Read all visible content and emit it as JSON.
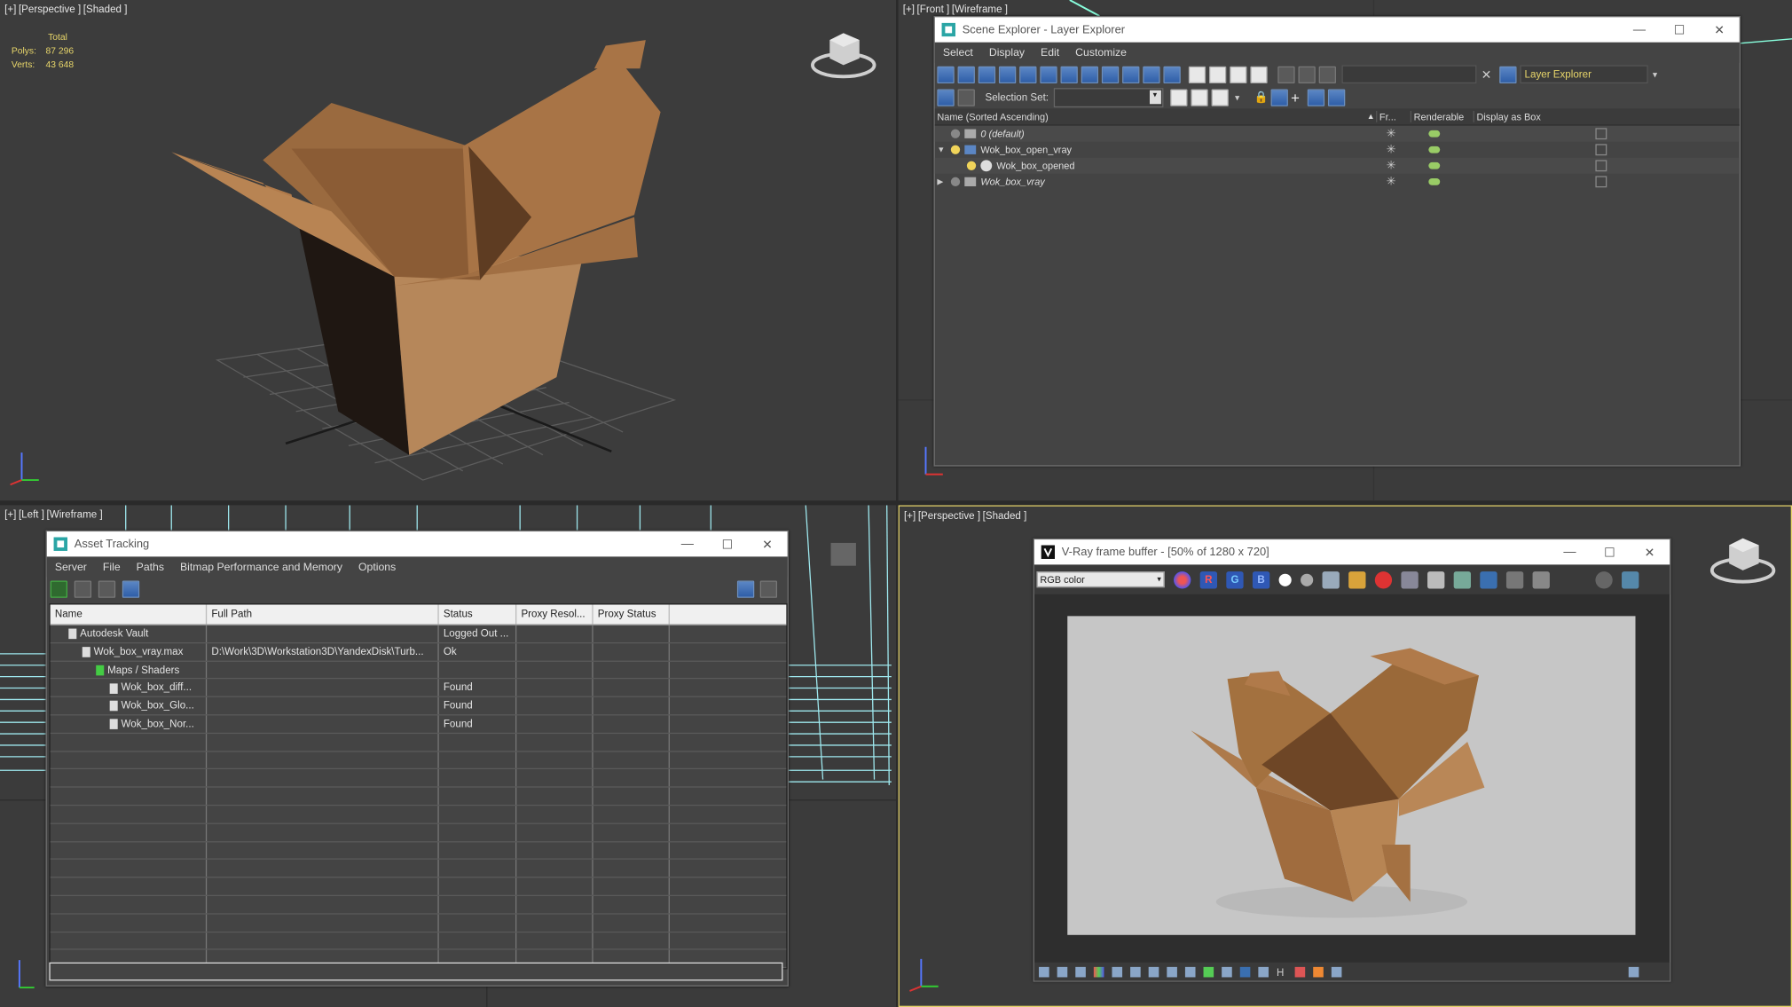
{
  "viewports": {
    "top_left": {
      "labels": [
        "[+]",
        "[Perspective ]",
        "[Shaded ]"
      ],
      "stats": {
        "header": "Total",
        "polys_label": "Polys:",
        "polys": "87 296",
        "verts_label": "Verts:",
        "verts": "43 648"
      }
    },
    "top_right": {
      "labels": [
        "[+]",
        "[Front ]",
        "[Wireframe ]"
      ]
    },
    "bottom_left": {
      "labels": [
        "[+]",
        "[Left ]",
        "[Wireframe ]"
      ]
    },
    "bottom_right": {
      "labels": [
        "[+]",
        "[Perspective ]",
        "[Shaded ]"
      ]
    }
  },
  "scene_explorer": {
    "title": "Scene Explorer - Layer Explorer",
    "menu": [
      "Select",
      "Display",
      "Edit",
      "Customize"
    ],
    "mode_dropdown": "Layer Explorer",
    "selection_set_label": "Selection Set:",
    "columns": [
      "Name (Sorted Ascending)",
      "Fr...",
      "Renderable",
      "Display as Box"
    ],
    "rows": [
      {
        "name": "0 (default)",
        "italic": true,
        "indent": 0,
        "expander": ""
      },
      {
        "name": "Wok_box_open_vray",
        "italic": false,
        "indent": 0,
        "expander": "▼"
      },
      {
        "name": "Wok_box_opened",
        "italic": false,
        "indent": 1,
        "expander": ""
      },
      {
        "name": "Wok_box_vray",
        "italic": true,
        "indent": 0,
        "expander": "▶"
      }
    ]
  },
  "asset_tracking": {
    "title": "Asset Tracking",
    "menu": [
      "Server",
      "File",
      "Paths",
      "Bitmap Performance and Memory",
      "Options"
    ],
    "columns": [
      "Name",
      "Full Path",
      "Status",
      "Proxy Resol...",
      "Proxy Status"
    ],
    "rows": [
      {
        "name": "Autodesk Vault",
        "path": "",
        "status": "Logged Out ...",
        "indent": 1
      },
      {
        "name": "Wok_box_vray.max",
        "path": "D:\\Work\\3D\\Workstation3D\\YandexDisk\\Turb...",
        "status": "Ok",
        "indent": 2
      },
      {
        "name": "Maps / Shaders",
        "path": "",
        "status": "",
        "indent": 3
      },
      {
        "name": "Wok_box_diff...",
        "path": "",
        "status": "Found",
        "indent": 4
      },
      {
        "name": "Wok_box_Glo...",
        "path": "",
        "status": "Found",
        "indent": 4
      },
      {
        "name": "Wok_box_Nor...",
        "path": "",
        "status": "Found",
        "indent": 4
      }
    ],
    "empty_rows": 13
  },
  "vray_fb": {
    "title": "V-Ray frame buffer - [50% of 1280 x 720]",
    "channel": "RGB color",
    "r": "R",
    "g": "G",
    "b": "B"
  },
  "colors": {
    "accent": "#2e5ea8",
    "background": "#3d3d3d",
    "box": "#b07a4a",
    "render_bg": "#c6c6c6"
  }
}
